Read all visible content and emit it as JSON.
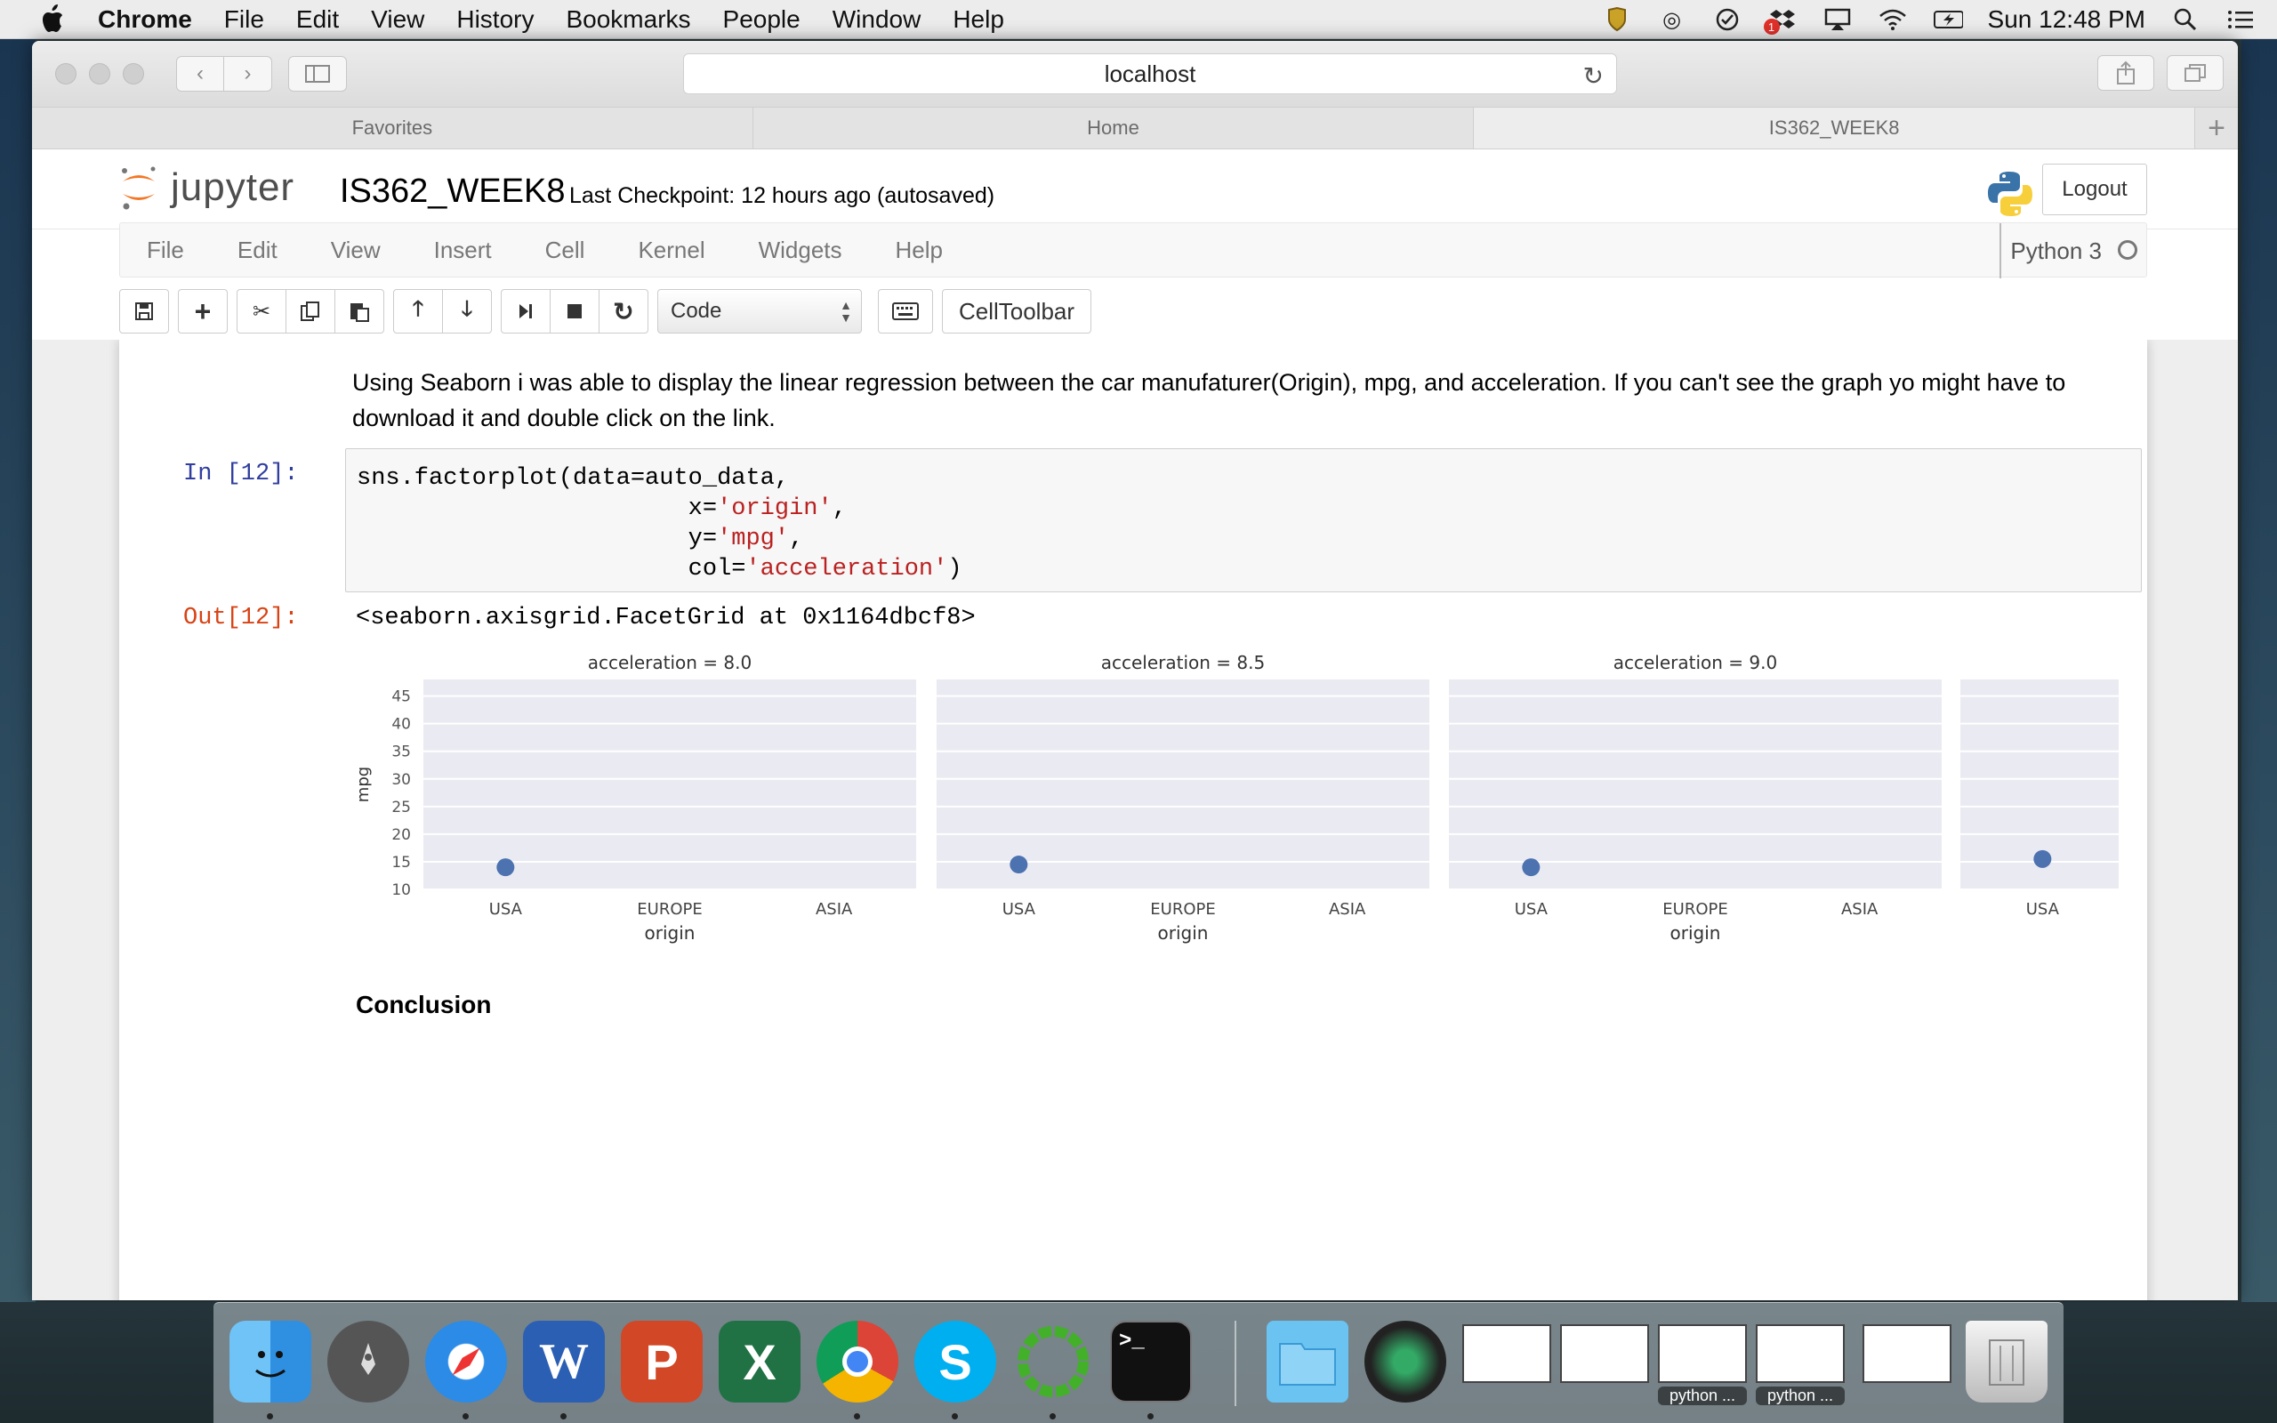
{
  "menubar": {
    "app": "Chrome",
    "items": [
      "File",
      "Edit",
      "View",
      "History",
      "Bookmarks",
      "People",
      "Window",
      "Help"
    ],
    "clock": "Sun 12:48 PM",
    "badge_count": "1"
  },
  "browser": {
    "url": "localhost",
    "tabs": [
      "Favorites",
      "Home",
      "IS362_WEEK8"
    ]
  },
  "jupyter": {
    "logo_text": "jupyter",
    "notebook_name": "IS362_WEEK8",
    "checkpoint": "Last Checkpoint: 12 hours ago (autosaved)",
    "logout": "Logout",
    "menu": [
      "File",
      "Edit",
      "View",
      "Insert",
      "Cell",
      "Kernel",
      "Widgets",
      "Help"
    ],
    "kernel": "Python 3",
    "cell_type": "Code",
    "celltoolbar": "CellToolbar"
  },
  "notebook": {
    "markdown": "Using Seaborn i was able to display the linear regression between the car manufaturer(Origin), mpg, and acceleration. If you can't see the graph yo might have to download it and double click on the link.",
    "in_prompt": "In [12]:",
    "code_line1": "sns.factorplot(data=auto_data,",
    "code_x_key": "                       x=",
    "code_x_val": "'origin'",
    "code_y_key": "                       y=",
    "code_y_val": "'mpg'",
    "code_col_key": "                       col=",
    "code_col_val": "'acceleration'",
    "out_prompt": "Out[12]:",
    "out_text": "<seaborn.axisgrid.FacetGrid at 0x1164dbcf8>",
    "conclusion": "Conclusion"
  },
  "chart_data": {
    "type": "scatter",
    "ylabel": "mpg",
    "xlabel": "origin",
    "categories": [
      "USA",
      "EUROPE",
      "ASIA"
    ],
    "ylim": [
      10,
      48
    ],
    "yticks": [
      10,
      15,
      20,
      25,
      30,
      35,
      40,
      45
    ],
    "grid": true,
    "panels": [
      {
        "title": "acceleration = 8.0",
        "points": [
          {
            "x": "USA",
            "y": 14
          }
        ]
      },
      {
        "title": "acceleration = 8.5",
        "points": [
          {
            "x": "USA",
            "y": 14.5
          }
        ]
      },
      {
        "title": "acceleration = 9.0",
        "points": [
          {
            "x": "USA",
            "y": 14
          }
        ]
      },
      {
        "title": "",
        "points": [
          {
            "x": "USA",
            "y": 15.5
          }
        ]
      }
    ],
    "colors": {
      "point": "#4c72b0",
      "panel_bg": "#eaeaf2",
      "grid": "#ffffff"
    }
  },
  "dock": {
    "labels": [
      "python ...",
      "python ..."
    ]
  }
}
